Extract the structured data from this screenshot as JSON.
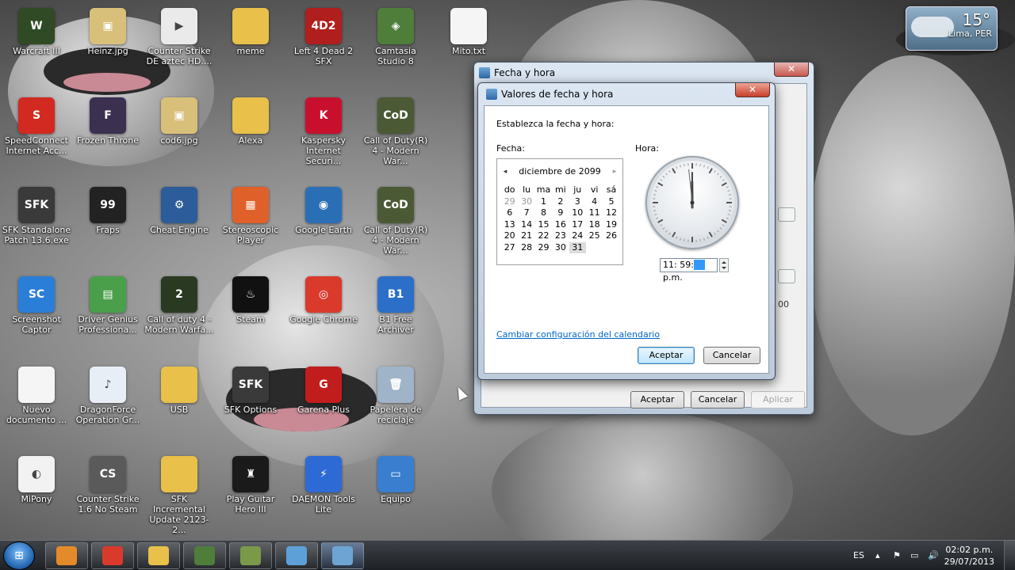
{
  "desktop": {
    "icons": [
      {
        "label": "Warcraft III",
        "icon": "warcraft-icon",
        "color": "#2f4a24",
        "glyph": "W"
      },
      {
        "label": "Heinz.jpg",
        "icon": "image-file-icon",
        "color": "#d9c07a",
        "glyph": "▣"
      },
      {
        "label": "Counter Strike DE aztec HD....",
        "icon": "video-file-icon",
        "color": "#eaeaea",
        "glyph": "▶"
      },
      {
        "label": "meme",
        "icon": "folder-icon",
        "color": "#e8c04a",
        "glyph": ""
      },
      {
        "label": "Left 4 Dead 2 SFX",
        "icon": "l4d2-icon",
        "color": "#b01e1e",
        "glyph": "4D2"
      },
      {
        "label": "Camtasia Studio 8",
        "icon": "camtasia-icon",
        "color": "#4f7d3a",
        "glyph": "◈"
      },
      {
        "label": "Mito.txt",
        "icon": "text-file-icon",
        "color": "#f5f5f5",
        "glyph": ""
      },
      {
        "label": "SpeedConnect Internet Acc...",
        "icon": "speedconnect-icon",
        "color": "#d22a20",
        "glyph": "S"
      },
      {
        "label": "Frozen Throne",
        "icon": "frozen-throne-icon",
        "color": "#3b3050",
        "glyph": "F"
      },
      {
        "label": "cod6.jpg",
        "icon": "image-file-icon",
        "color": "#d9c07a",
        "glyph": "▣"
      },
      {
        "label": "Alexa",
        "icon": "folder-icon",
        "color": "#e8c04a",
        "glyph": ""
      },
      {
        "label": "Kaspersky Internet Securi...",
        "icon": "kaspersky-icon",
        "color": "#c8102e",
        "glyph": "K"
      },
      {
        "label": "Call of Duty(R) 4 - Modern War...",
        "icon": "cod4-icon",
        "color": "#4b5a35",
        "glyph": "CoD"
      },
      {
        "label": "SFK Standalone Patch 13.6.exe",
        "icon": "sfk-patch-icon",
        "color": "#3a3a3a",
        "glyph": "SFK"
      },
      {
        "label": "Fraps",
        "icon": "fraps-icon",
        "color": "#222222",
        "glyph": "99"
      },
      {
        "label": "Cheat Engine",
        "icon": "cheat-engine-icon",
        "color": "#2c5d9a",
        "glyph": "⚙"
      },
      {
        "label": "Stereoscopic Player",
        "icon": "stereoscopic-player-icon",
        "color": "#e0602a",
        "glyph": "▦"
      },
      {
        "label": "Google Earth",
        "icon": "google-earth-icon",
        "color": "#2a6fb5",
        "glyph": "◉"
      },
      {
        "label": "Call of Duty(R) 4 - Modern War...",
        "icon": "cod4-icon",
        "color": "#4b5a35",
        "glyph": "CoD"
      },
      {
        "label": "Screenshot Captor",
        "icon": "screenshot-captor-icon",
        "color": "#2a7ed8",
        "glyph": "SC"
      },
      {
        "label": "Driver Genius Professiona...",
        "icon": "driver-genius-icon",
        "color": "#4aa04a",
        "glyph": "▤"
      },
      {
        "label": "Call of duty 4 - Modern Warfa...",
        "icon": "cod4-mw-icon",
        "color": "#2a3a22",
        "glyph": "2"
      },
      {
        "label": "Steam",
        "icon": "steam-icon",
        "color": "#111111",
        "glyph": "♨"
      },
      {
        "label": "Google Chrome",
        "icon": "chrome-icon",
        "color": "#d93a2b",
        "glyph": "◎"
      },
      {
        "label": "B1 Free Archiver",
        "icon": "b1-archiver-icon",
        "color": "#2c6fc9",
        "glyph": "B1"
      },
      {
        "label": "Nuevo documento ...",
        "icon": "text-file-icon",
        "color": "#f5f5f5",
        "glyph": ""
      },
      {
        "label": "DragonForce Operation Gr...",
        "icon": "audio-file-icon",
        "color": "#e8eef6",
        "glyph": "♪"
      },
      {
        "label": "USB",
        "icon": "folder-icon",
        "color": "#e8c04a",
        "glyph": ""
      },
      {
        "label": "SFK Options",
        "icon": "sfk-options-icon",
        "color": "#3a3a3a",
        "glyph": "SFK"
      },
      {
        "label": "Garena Plus",
        "icon": "garena-icon",
        "color": "#c21d1d",
        "glyph": "G"
      },
      {
        "label": "Papelera de reciclaje",
        "icon": "recycle-bin-icon",
        "color": "#9fb4c8",
        "glyph": "🗑"
      },
      {
        "label": "MiPony",
        "icon": "mipony-icon",
        "color": "#f2f2f2",
        "glyph": "◐"
      },
      {
        "label": "Counter Strike 1.6 No Steam",
        "icon": "counter-strike-icon",
        "color": "#5a5a5a",
        "glyph": "CS"
      },
      {
        "label": "SFK Incremental Update 2123-2...",
        "icon": "folder-icon",
        "color": "#e8c04a",
        "glyph": ""
      },
      {
        "label": "Play Guitar Hero III",
        "icon": "guitar-hero-icon",
        "color": "#1a1a1a",
        "glyph": "♜"
      },
      {
        "label": "DAEMON Tools Lite",
        "icon": "daemon-tools-icon",
        "color": "#2d6ad6",
        "glyph": "⚡"
      },
      {
        "label": "Equipo",
        "icon": "computer-icon",
        "color": "#3a7fcf",
        "glyph": "▭"
      }
    ]
  },
  "weather": {
    "temperature": "15°",
    "city": "Lima, PER"
  },
  "outer_window": {
    "title": "Fecha y hora",
    "ghost_text": "00",
    "buttons": {
      "accept": "Aceptar",
      "cancel": "Cancelar",
      "apply": "Aplicar"
    }
  },
  "dialog": {
    "title": "Valores de fecha y hora",
    "instruction": "Establezca la fecha y hora:",
    "date_label": "Fecha:",
    "time_label": "Hora:",
    "calendar": {
      "month_title": "diciembre de 2099",
      "prev": "◂",
      "next": "▸",
      "weekdays": [
        "do",
        "lu",
        "ma",
        "mi",
        "ju",
        "vi",
        "sá"
      ],
      "weeks": [
        [
          "29",
          "30",
          "1",
          "2",
          "3",
          "4",
          "5"
        ],
        [
          "6",
          "7",
          "8",
          "9",
          "10",
          "11",
          "12"
        ],
        [
          "13",
          "14",
          "15",
          "16",
          "17",
          "18",
          "19"
        ],
        [
          "20",
          "21",
          "22",
          "23",
          "24",
          "25",
          "26"
        ],
        [
          "27",
          "28",
          "29",
          "30",
          "31",
          "",
          ""
        ]
      ],
      "dim_days_first_week": 2,
      "selected_day": "31"
    },
    "time": {
      "hours_minutes": "11: 59:",
      "seconds": "59",
      "ampm": " p.m."
    },
    "clock_time": {
      "hour": 11,
      "minute": 59,
      "second": 59
    },
    "link": "Cambiar configuración del calendario",
    "buttons": {
      "accept": "Aceptar",
      "cancel": "Cancelar"
    }
  },
  "taskbar": {
    "start_glyph": "⊞",
    "apps": [
      {
        "name": "media-player-icon",
        "color": "#e38b2a"
      },
      {
        "name": "chrome-icon",
        "color": "#d93a2b"
      },
      {
        "name": "explorer-icon",
        "color": "#e8c04a"
      },
      {
        "name": "camtasia-icon",
        "color": "#4f7d3a"
      },
      {
        "name": "camtasia-recorder-icon",
        "color": "#7a9a4a"
      },
      {
        "name": "screenshot-icon",
        "color": "#5da0d8"
      },
      {
        "name": "date-time-icon",
        "color": "#6ea4d4"
      }
    ],
    "language": "ES",
    "time": "02:02 p.m.",
    "date": "29/07/2013"
  }
}
